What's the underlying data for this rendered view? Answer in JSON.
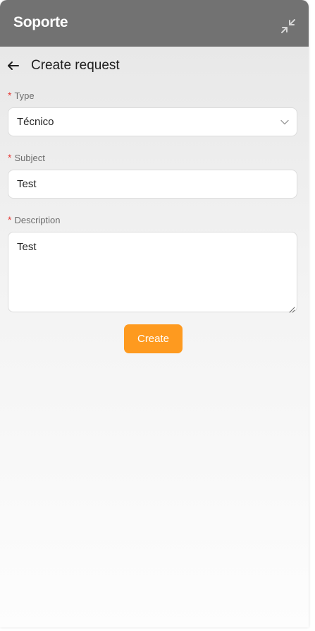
{
  "header": {
    "title": "Soporte",
    "collapse_icon": "collapse-arrows-icon"
  },
  "subheader": {
    "back_icon": "arrow-left-icon",
    "title": "Create request"
  },
  "form": {
    "required_marker": "*",
    "type": {
      "label": "Type",
      "value": "Técnico",
      "icon": "chevron-down-icon"
    },
    "subject": {
      "label": "Subject",
      "value": "Test"
    },
    "description": {
      "label": "Description",
      "value": "Test"
    },
    "submit_label": "Create"
  },
  "colors": {
    "header_bg": "#727272",
    "accent": "#fe9a1f",
    "required": "#e53935"
  }
}
